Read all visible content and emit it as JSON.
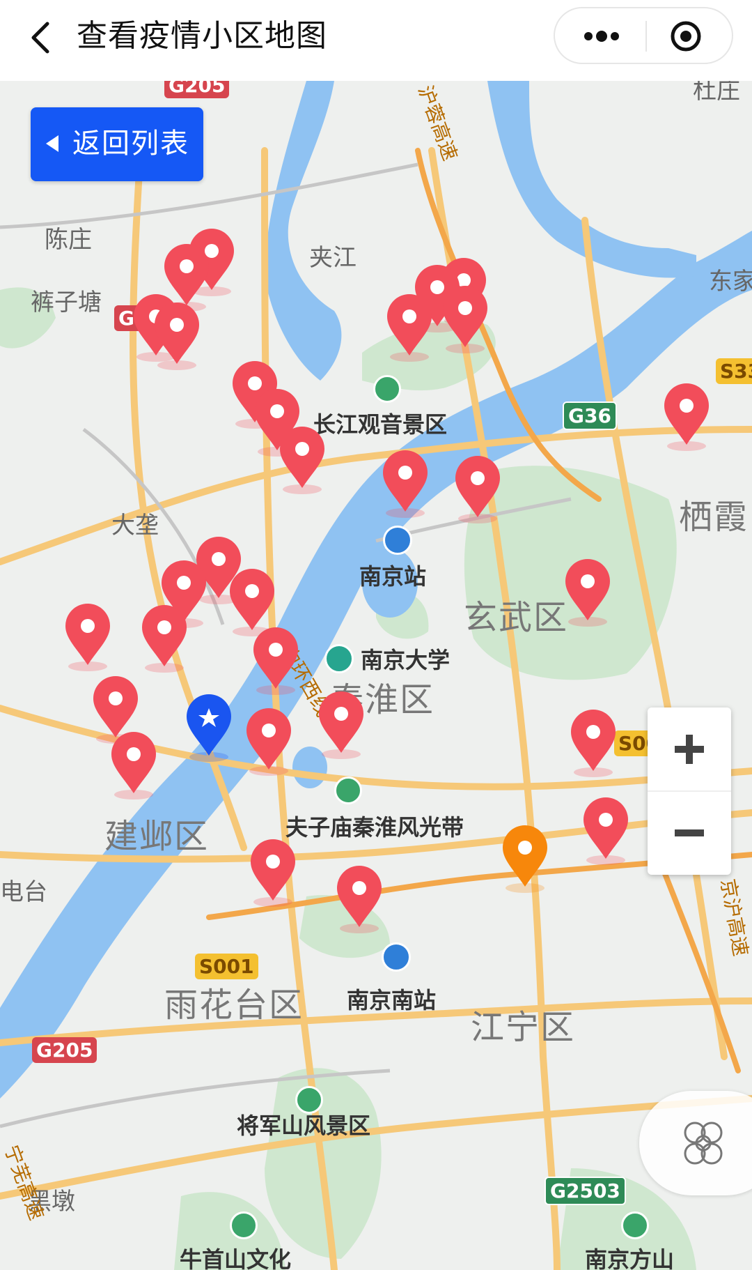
{
  "header": {
    "back_icon": "chevron-left-icon",
    "title": "查看疫情小区地图",
    "more_icon": "more-dots-icon",
    "close_icon": "target-close-icon"
  },
  "back_to_list": {
    "label": "返回列表",
    "icon": "triangle-left-icon",
    "color": "#1558f5"
  },
  "zoom": {
    "in_icon": "plus-icon",
    "out_icon": "minus-icon"
  },
  "locate": {
    "icon": "locate-icon"
  },
  "colors": {
    "case_marker": "#f24d5a",
    "user_marker": "#1a55f0",
    "highlight_marker": "#f7870b",
    "water": "#8fc2f2",
    "park": "#cfe7cf"
  },
  "map": {
    "place_labels": [
      "陈庄",
      "裤子塘",
      "夹江",
      "大垄",
      "东家",
      "杜庄",
      "电台",
      "黑墩",
      "栖霞"
    ],
    "district_labels": [
      "玄武区",
      "秦淮区",
      "雨花台区",
      "江宁区",
      "建邺区"
    ],
    "poi_labels": [
      "长江观音景区",
      "南京站",
      "南京大学",
      "夫子庙秦淮风光带",
      "南京南站",
      "将军山风景区",
      "牛首山文化",
      "南京方山"
    ],
    "road_labels": [
      "内环西线",
      "沪蓉高速",
      "京沪高速",
      "宁芜高速"
    ],
    "road_shields": [
      {
        "text": "G205",
        "style": "red"
      },
      {
        "text": "G205",
        "style": "red"
      },
      {
        "text": "G205",
        "style": "red"
      },
      {
        "text": "G36",
        "style": "green"
      },
      {
        "text": "G2503",
        "style": "green"
      },
      {
        "text": "S33",
        "style": "yellow"
      },
      {
        "text": "S001",
        "style": "yellow"
      },
      {
        "text": "S00",
        "style": "yellow"
      }
    ],
    "markers": [
      {
        "type": "case"
      },
      {
        "type": "case"
      },
      {
        "type": "case"
      },
      {
        "type": "case"
      },
      {
        "type": "case"
      },
      {
        "type": "case"
      },
      {
        "type": "case"
      },
      {
        "type": "case"
      },
      {
        "type": "case"
      },
      {
        "type": "case"
      },
      {
        "type": "case"
      },
      {
        "type": "case"
      },
      {
        "type": "case"
      },
      {
        "type": "case"
      },
      {
        "type": "case"
      },
      {
        "type": "case"
      },
      {
        "type": "case"
      },
      {
        "type": "case"
      },
      {
        "type": "case"
      },
      {
        "type": "case"
      },
      {
        "type": "case"
      },
      {
        "type": "case"
      },
      {
        "type": "case"
      },
      {
        "type": "case"
      },
      {
        "type": "case"
      },
      {
        "type": "case"
      },
      {
        "type": "case"
      },
      {
        "type": "case"
      },
      {
        "type": "case"
      },
      {
        "type": "user"
      },
      {
        "type": "highlight"
      }
    ]
  }
}
